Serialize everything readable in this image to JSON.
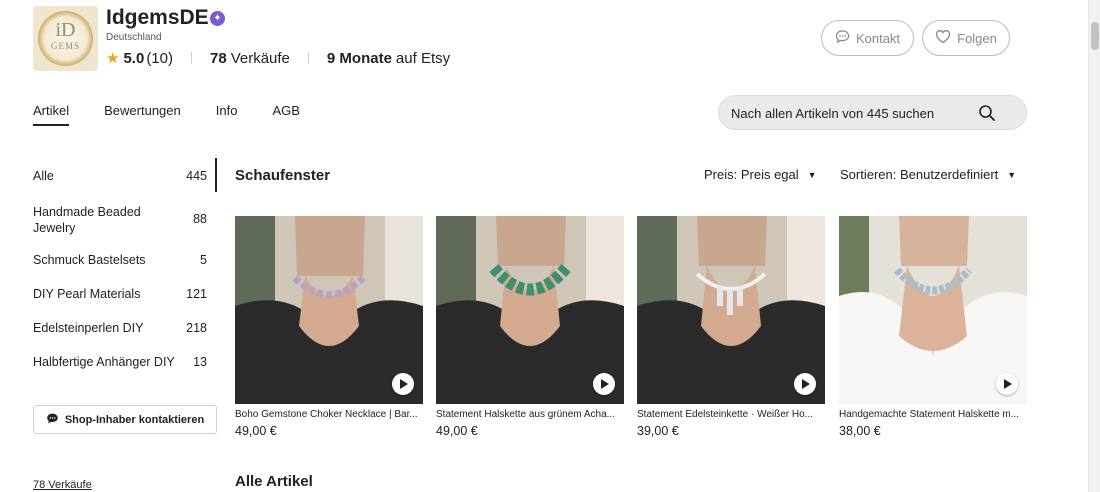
{
  "shop": {
    "logo_text": "iD",
    "logo_subtext": "GEMS",
    "name": "IdgemsDE",
    "country": "Deutschland",
    "rating": "5.0",
    "reviews": "(10)",
    "sales_count": "78",
    "sales_label": "Verkäufe",
    "months": "9 Monate",
    "months_suffix": "auf Etsy"
  },
  "header_buttons": {
    "contact_label": "Kontakt",
    "follow_label": "Folgen"
  },
  "tabs": [
    {
      "label": "Artikel",
      "active": true
    },
    {
      "label": "Bewertungen",
      "active": false
    },
    {
      "label": "Info",
      "active": false
    },
    {
      "label": "AGB",
      "active": false
    }
  ],
  "search": {
    "placeholder": "Nach allen Artikeln von 445 suchen"
  },
  "sidebar": {
    "categories": [
      {
        "name": "Alle",
        "count": "445"
      },
      {
        "name": "Handmade Beaded Jewelry",
        "count": "88"
      },
      {
        "name": "Schmuck Bastelsets",
        "count": "5"
      },
      {
        "name": "DIY Pearl Materials",
        "count": "121"
      },
      {
        "name": "Edelsteinperlen DIY",
        "count": "218"
      },
      {
        "name": "Halbfertige Anhänger DIY",
        "count": "13"
      }
    ],
    "contact_owner_label": "Shop-Inhaber kontaktieren",
    "sales_link": "78 Verkäufe"
  },
  "main": {
    "section_title": "Schaufenster",
    "price_filter": "Preis: Preis egal",
    "sort_filter": "Sortieren: Benutzerdefiniert",
    "all_items_title": "Alle Artikel",
    "listings": [
      {
        "title": "Boho Gemstone Choker Necklace | Bar...",
        "price": "49,00 €"
      },
      {
        "title": "Statement Halskette aus grünem Acha...",
        "price": "49,00 €"
      },
      {
        "title": "Statement Edelsteinkette · Weißer Ho...",
        "price": "39,00 €"
      },
      {
        "title": "Handgemachte Statement Halskette m...",
        "price": "38,00 €"
      }
    ]
  },
  "colors": {
    "accent_star": "#e6a417",
    "star_seller_badge": "#7b5bd0",
    "text": "#222222"
  }
}
